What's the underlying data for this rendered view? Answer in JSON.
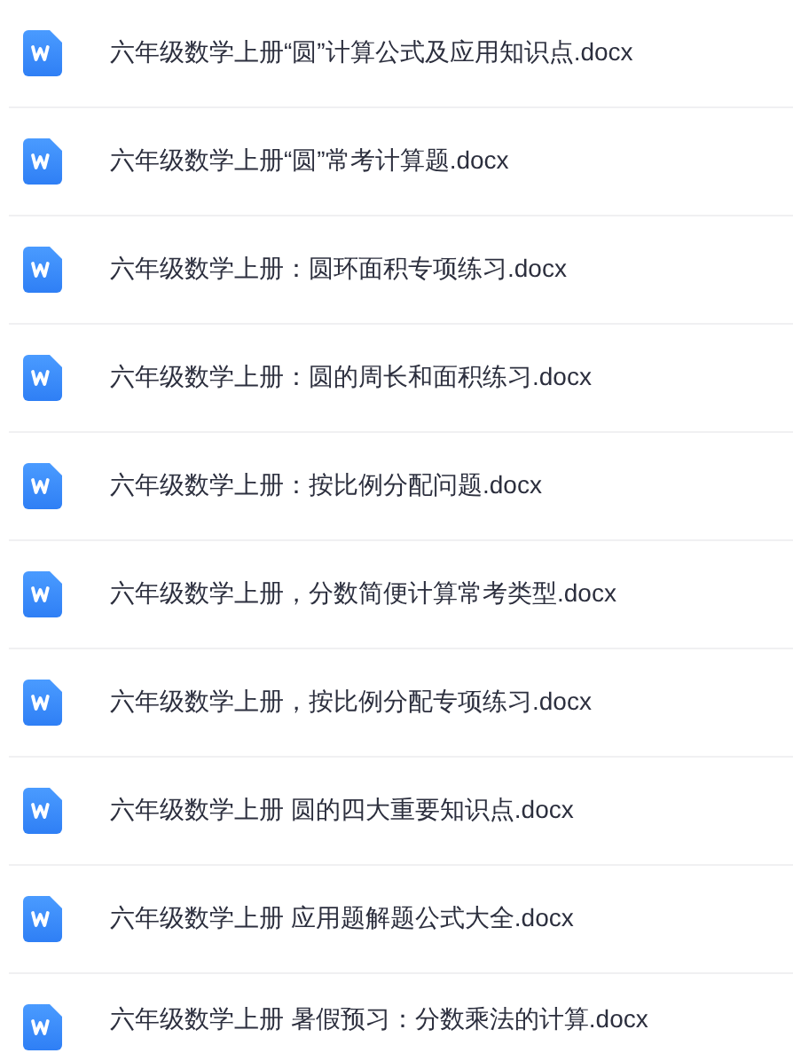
{
  "files": [
    {
      "name": "六年级数学上册“圆”计算公式及应用知识点.docx",
      "kind": "word"
    },
    {
      "name": "六年级数学上册“圆”常考计算题.docx",
      "kind": "word"
    },
    {
      "name": "六年级数学上册：圆环面积专项练习.docx",
      "kind": "word"
    },
    {
      "name": "六年级数学上册：圆的周长和面积练习.docx",
      "kind": "word"
    },
    {
      "name": "六年级数学上册：按比例分配问题.docx",
      "kind": "word"
    },
    {
      "name": "六年级数学上册，分数简便计算常考类型.docx",
      "kind": "word"
    },
    {
      "name": "六年级数学上册，按比例分配专项练习.docx",
      "kind": "word"
    },
    {
      "name": "六年级数学上册 圆的四大重要知识点.docx",
      "kind": "word"
    },
    {
      "name": "六年级数学上册 应用题解题公式大全.docx",
      "kind": "word"
    },
    {
      "name": "六年级数学上册 暑假预习：分数乘法的计算.docx",
      "kind": "word"
    }
  ]
}
